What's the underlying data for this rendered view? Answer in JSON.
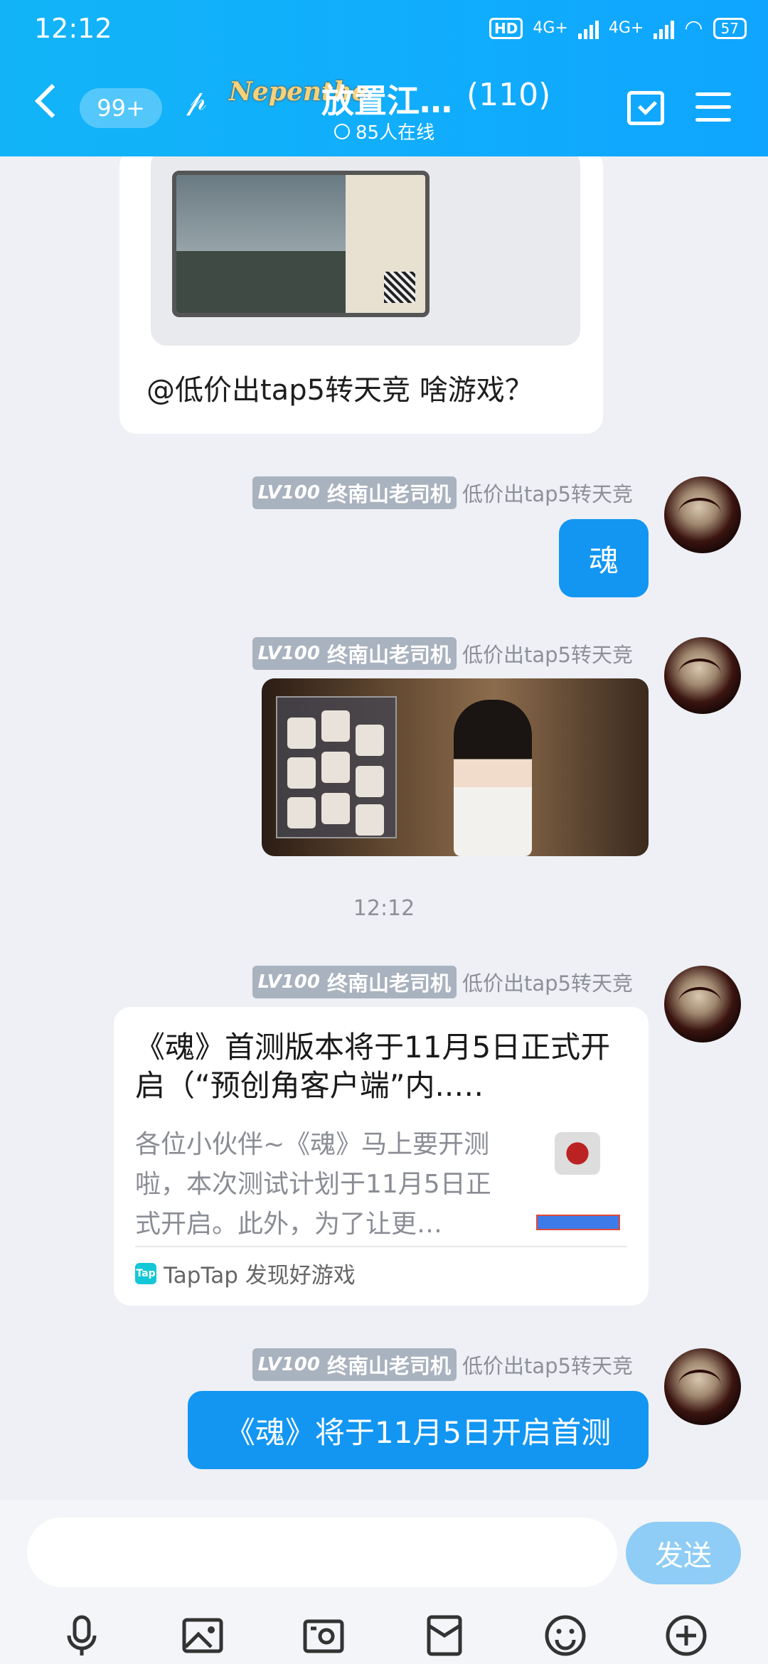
{
  "status_bar": {
    "time": "12:12",
    "network1": "4G+",
    "network2": "4G+",
    "battery": "57",
    "hd": "HD"
  },
  "header": {
    "unread_badge": "99+",
    "group_logo": "Nepenthe",
    "group_name": "放置江…",
    "member_count": "(110)",
    "online_text": "85人在线"
  },
  "messages": {
    "card_top": {
      "caption": "@低价出tap5转天竞 啥游戏？"
    },
    "sender": {
      "level": "LV100",
      "title": "终南山老司机",
      "name": "低价出tap5转天竞"
    },
    "msg1": {
      "text": "魂"
    },
    "timestamp": "12:12",
    "link_card": {
      "title": "《魂》首测版本将于11月5日正式开启（“预创角客户端”内..…",
      "desc": "各位小伙伴~《魂》马上要开测啦，本次测试计划于11月5日正式开启。此外，为了让更…",
      "source": "TapTap 发现好游戏",
      "source_logo": "Tap"
    },
    "msg_last": {
      "text": "《魂》将于11月5日开启首测"
    }
  },
  "input": {
    "placeholder": "",
    "send_label": "发送"
  },
  "colors": {
    "header": "#11aefc",
    "bubble": "#1296f2",
    "send": "#8fcdf6"
  }
}
